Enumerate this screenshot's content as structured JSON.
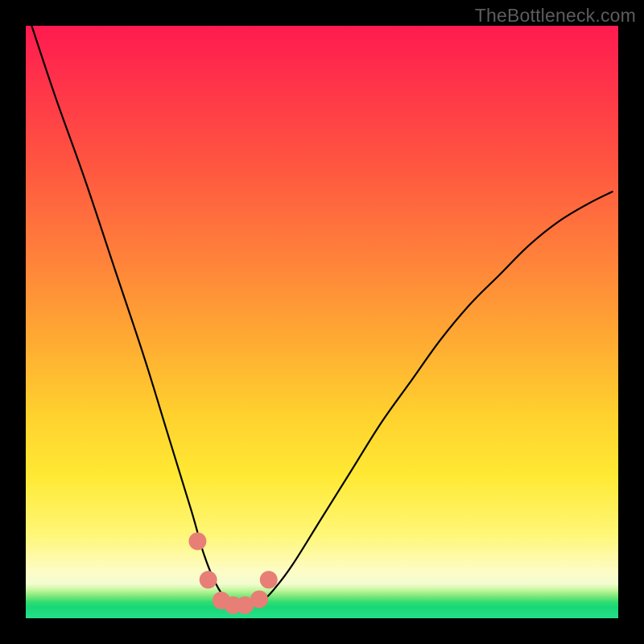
{
  "watermark": "TheBottleneck.com",
  "chart_data": {
    "type": "line",
    "title": "",
    "xlabel": "",
    "ylabel": "",
    "xlim": [
      0,
      100
    ],
    "ylim": [
      0,
      100
    ],
    "grid": false,
    "series": [
      {
        "name": "bottleneck-curve",
        "x": [
          1,
          5,
          10,
          15,
          20,
          24,
          28,
          30,
          32,
          34,
          36,
          38,
          40,
          42,
          45,
          50,
          55,
          60,
          65,
          70,
          75,
          80,
          85,
          90,
          95,
          99
        ],
        "values": [
          100,
          88,
          74,
          59,
          44,
          31,
          18,
          11,
          6,
          3,
          2,
          2,
          3,
          5,
          9,
          17,
          25,
          33,
          40,
          47,
          53,
          58,
          63,
          67,
          70,
          72
        ]
      }
    ],
    "markers": {
      "name": "highlight-dots",
      "color": "#e77f76",
      "x": [
        29.0,
        30.8,
        33.0,
        35.0,
        37.0,
        39.4,
        41.0
      ],
      "values": [
        13.0,
        6.5,
        3.0,
        2.2,
        2.2,
        3.2,
        6.5
      ]
    },
    "background_gradient": {
      "top": "#ff1a4f",
      "mid_upper": "#ff7e3b",
      "mid": "#ffd22e",
      "lower": "#fdfcc5",
      "bottom_band": "#25e08a"
    }
  }
}
